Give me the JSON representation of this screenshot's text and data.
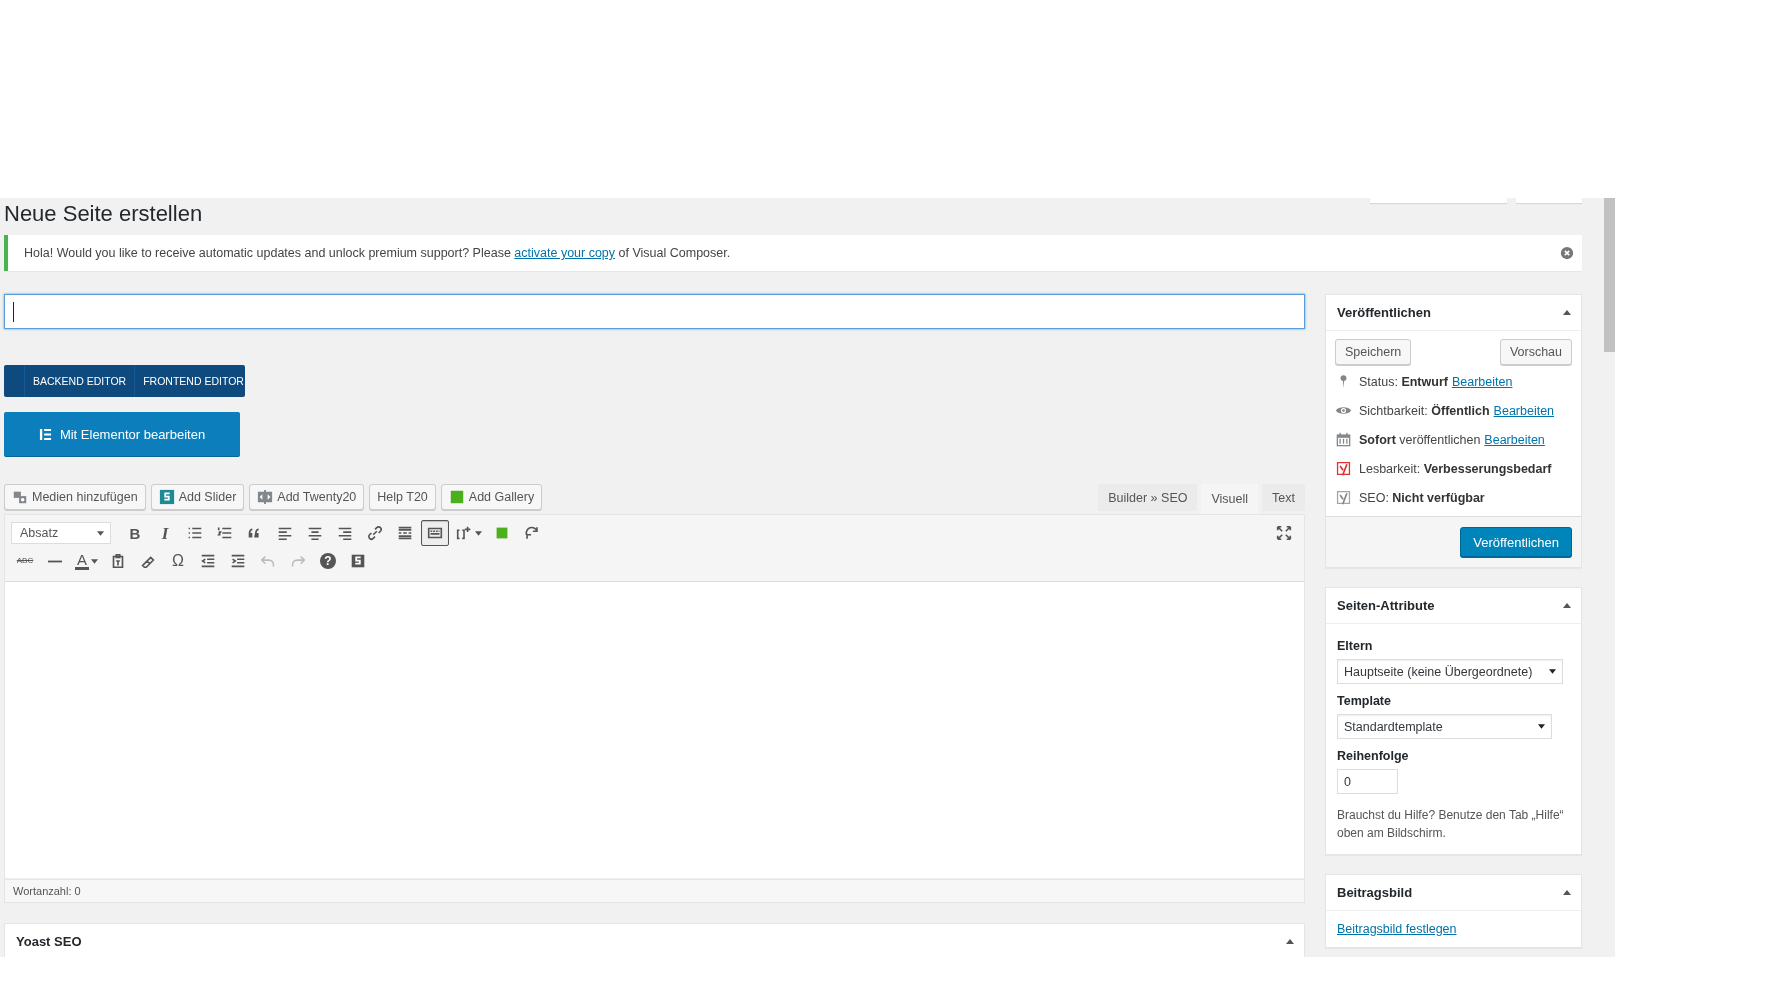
{
  "page_title": "Neue Seite erstellen",
  "notice": {
    "text_before": "Hola! Would you like to receive automatic updates and unlock premium support? Please ",
    "link": "activate your copy",
    "text_after": " of Visual Composer."
  },
  "title_field": {
    "focused": true
  },
  "vc_switch": [
    {
      "label": "BACKEND EDITOR"
    },
    {
      "label": "FRONTEND EDITOR"
    }
  ],
  "elementor_button": "Mit Elementor bearbeiten",
  "media_buttons": [
    {
      "label": "Medien hinzufügen",
      "kind": "media"
    },
    {
      "label": "Add Slider",
      "kind": "slider"
    },
    {
      "label": "Add Twenty20",
      "kind": "twenty"
    },
    {
      "label": "Help T20",
      "kind": "plain"
    },
    {
      "label": "Add Gallery",
      "kind": "gallery"
    }
  ],
  "editor_tabs": [
    {
      "label": "Builder » SEO",
      "selected": false
    },
    {
      "label": "Visuell",
      "selected": true
    },
    {
      "label": "Text",
      "selected": false
    }
  ],
  "format_select": "Absatz",
  "toolbar_rows": [
    [
      {
        "kind": "bold",
        "glyph": "B",
        "pressed": false,
        "disabled": false
      },
      {
        "kind": "italic",
        "glyph": "I",
        "pressed": false,
        "disabled": false
      },
      {
        "kind": "bullet-list",
        "pressed": false,
        "disabled": false
      },
      {
        "kind": "numbered-list",
        "pressed": false,
        "disabled": false
      },
      {
        "kind": "quote",
        "pressed": false,
        "disabled": false
      },
      {
        "kind": "align-left",
        "pressed": false,
        "disabled": false
      },
      {
        "kind": "align-center",
        "pressed": false,
        "disabled": false
      },
      {
        "kind": "align-right",
        "pressed": false,
        "disabled": false
      },
      {
        "kind": "link",
        "pressed": false,
        "disabled": false
      },
      {
        "kind": "read-more",
        "pressed": false,
        "disabled": false
      },
      {
        "kind": "toolbar-toggle",
        "pressed": true,
        "disabled": false
      },
      {
        "kind": "shortcode",
        "dropdown": true,
        "pressed": false,
        "disabled": false
      },
      {
        "kind": "green-square",
        "pressed": false,
        "disabled": false
      },
      {
        "kind": "refresh",
        "pressed": false,
        "disabled": false
      }
    ],
    [
      {
        "kind": "strikethrough",
        "glyph": "ABC",
        "pressed": false,
        "disabled": false
      },
      {
        "kind": "horizontal-line",
        "pressed": false,
        "disabled": false
      },
      {
        "kind": "text-color",
        "glyph": "A",
        "dropdown": true,
        "pressed": false,
        "disabled": false
      },
      {
        "kind": "paste-text",
        "pressed": false,
        "disabled": false
      },
      {
        "kind": "clear-format",
        "pressed": false,
        "disabled": false
      },
      {
        "kind": "special-char",
        "glyph": "Ω",
        "pressed": false,
        "disabled": false
      },
      {
        "kind": "outdent",
        "pressed": false,
        "disabled": false
      },
      {
        "kind": "indent",
        "pressed": false,
        "disabled": false
      },
      {
        "kind": "undo",
        "pressed": false,
        "disabled": true
      },
      {
        "kind": "redo",
        "pressed": false,
        "disabled": true
      },
      {
        "kind": "help",
        "glyph": "?",
        "pressed": false,
        "disabled": false
      },
      {
        "kind": "slider-s",
        "pressed": false,
        "disabled": false
      }
    ]
  ],
  "word_count": "Wortanzahl: 0",
  "yoast_box": {
    "title": "Yoast SEO",
    "expanded": true
  },
  "publish_box": {
    "title": "Veröffentlichen",
    "expanded": true,
    "save_button": "Speichern",
    "preview_button": "Vorschau",
    "rows": [
      {
        "kind": "status",
        "text": "Status: **Entwurf**",
        "link": "Bearbeiten"
      },
      {
        "kind": "visibility",
        "text": "Sichtbarkeit: **Öffentlich**",
        "link": "Bearbeiten"
      },
      {
        "kind": "schedule",
        "text": "**Sofort** veröffentlichen",
        "link": "Bearbeiten"
      },
      {
        "kind": "readability",
        "text": "Lesbarkeit: **Verbesserungsbedarf**"
      },
      {
        "kind": "seo",
        "text": "SEO: **Nicht verfügbar**"
      }
    ],
    "publish_button": "Veröffentlichen"
  },
  "attributes_box": {
    "title": "Seiten-Attribute",
    "expanded": true,
    "parent_label": "Eltern",
    "parent_value": "Hauptseite (keine Übergeordnete)",
    "template_label": "Template",
    "template_value": "Standardtemplate",
    "order_label": "Reihenfolge",
    "order_value": "0",
    "help": "Brauchst du Hilfe? Benutze den Tab „Hilfe“ oben am Bildschirm."
  },
  "featured_box": {
    "title": "Beitragsbild",
    "expanded": true,
    "link": "Beitragsbild festlegen"
  }
}
